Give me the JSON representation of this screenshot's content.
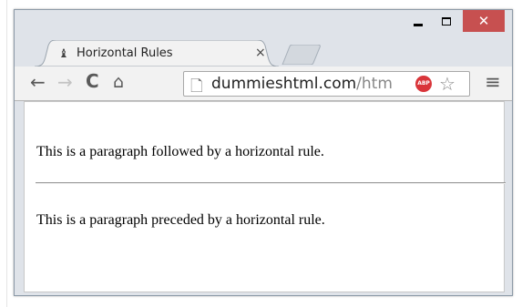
{
  "window": {
    "controls": {
      "minimize_icon": "minimize-icon",
      "maximize_icon": "maximize-icon",
      "close_glyph": "✕",
      "close_color": "#c75050"
    }
  },
  "tab": {
    "title": "Horizontal Rules",
    "close_glyph": "×",
    "favicon": "♝"
  },
  "toolbar": {
    "back": "←",
    "forward": "→",
    "reload": "C",
    "home": "⌂",
    "page_icon": "🗋",
    "url_host": "dummieshtml.com",
    "url_path": "/htm",
    "adblock_label": "ABP",
    "bookmark_star": "☆",
    "menu": "≡"
  },
  "content": {
    "paragraph_1": "This is a paragraph followed by a horizontal rule.",
    "paragraph_2": "This is a paragraph preceded by a horizontal rule."
  }
}
